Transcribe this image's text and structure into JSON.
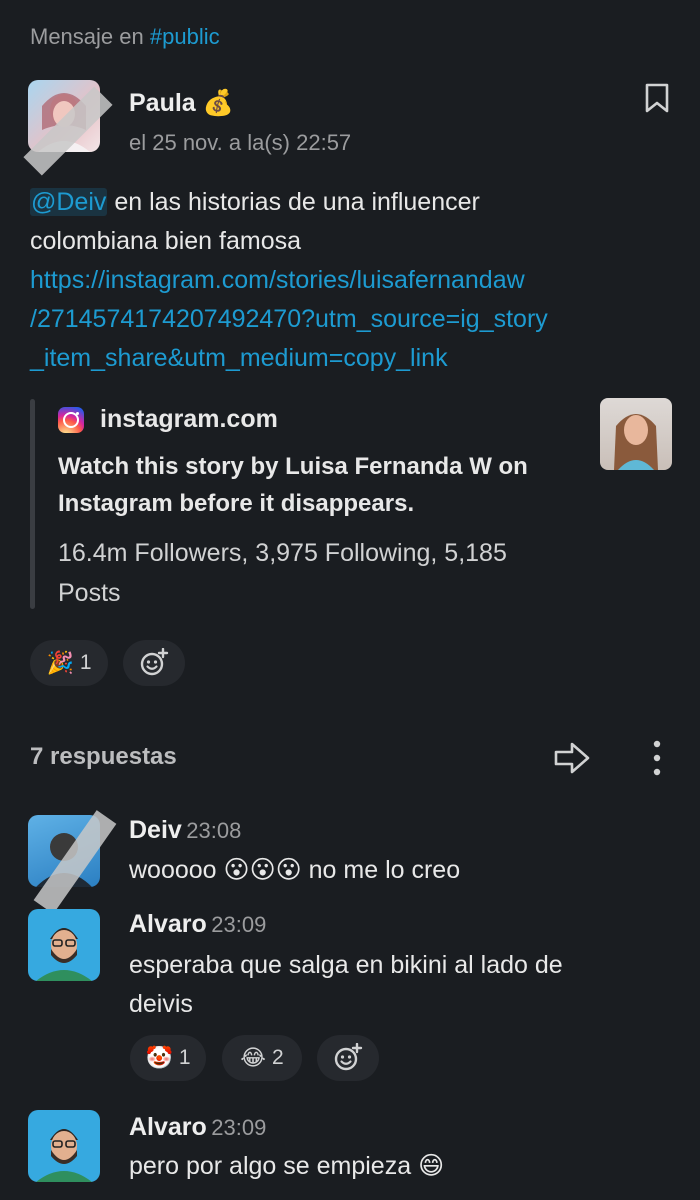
{
  "context": {
    "prefix": "Mensaje en",
    "channel": "#public"
  },
  "message": {
    "sender": "Paula",
    "sender_emoji": "💰",
    "timestamp": "el 25 nov. a la(s) 22:57",
    "mention": "@Deiv",
    "text_line1": " en las historias de una influencer",
    "text_line2": "colombiana bien  famosa",
    "link": "https://instagram.com/stories/luisafernandaw/2714574174207492470?utm_source=ig_story_item_share&utm_medium=copy_link",
    "link_line1": "https://instagram.com/stories/luisafernandaw",
    "link_line2": "/2714574174207492470?utm_source=ig_story",
    "link_line3": "_item_share&utm_medium=copy_link",
    "unfurl": {
      "site": "instagram.com",
      "title_line1": "Watch this story by Luisa Fernanda W on",
      "title_line2": "Instagram before it disappears.",
      "desc_line1": "16.4m Followers, 3,975 Following, 5,185",
      "desc_line2": "Posts"
    },
    "reactions": [
      {
        "emoji": "🎉",
        "count": "1"
      }
    ]
  },
  "thread": {
    "replies_label": "7 respuestas",
    "replies": [
      {
        "sender": "Deiv",
        "time": "23:08",
        "text": "wooooo 😮😮😮 no me lo creo"
      },
      {
        "sender": "Alvaro",
        "time": "23:09",
        "text_line1": "esperaba que salga en bikini al lado de",
        "text_line2": "deivis",
        "reactions": [
          {
            "emoji": "🤡",
            "count": "1"
          },
          {
            "emoji": "😂",
            "count": "2"
          }
        ]
      },
      {
        "sender": "Alvaro",
        "time": "23:09",
        "text": "pero por algo se empieza 😄"
      }
    ]
  }
}
